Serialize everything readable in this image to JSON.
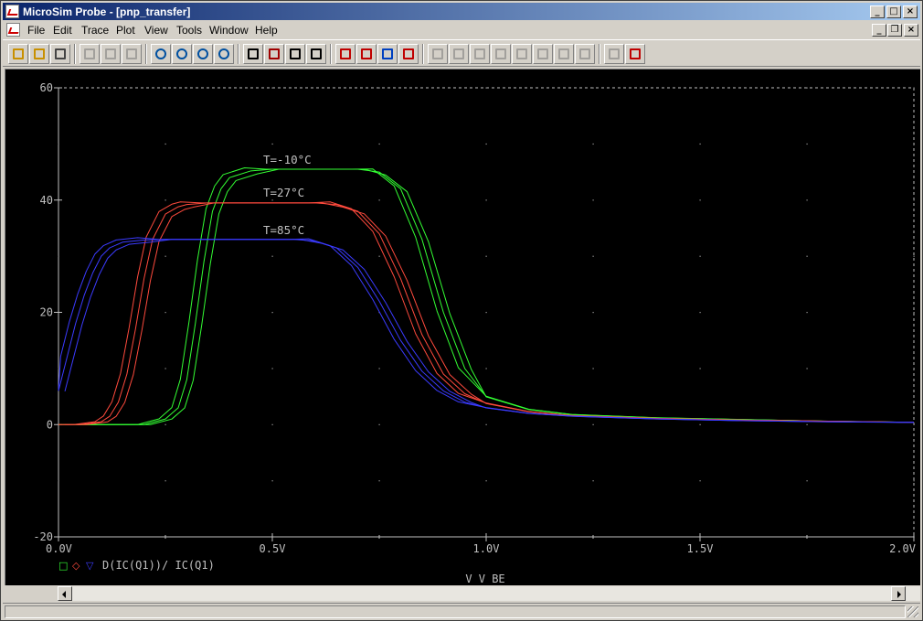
{
  "window": {
    "title": "MicroSim Probe - [pnp_transfer]",
    "caption_buttons": [
      "_",
      "□",
      "×"
    ],
    "mdi_buttons": [
      "_",
      "❐",
      "×"
    ]
  },
  "menu": [
    "File",
    "Edit",
    "Trace",
    "Plot",
    "View",
    "Tools",
    "Window",
    "Help"
  ],
  "toolbar": {
    "buttons": [
      {
        "name": "open-icon",
        "enabled": true
      },
      {
        "name": "append-icon",
        "enabled": true
      },
      {
        "name": "print-icon",
        "enabled": true
      },
      {
        "name": "cut-icon",
        "enabled": false
      },
      {
        "name": "copy-icon",
        "enabled": false
      },
      {
        "name": "paste-icon",
        "enabled": false
      },
      {
        "name": "zoom-in-icon",
        "enabled": true
      },
      {
        "name": "zoom-out-icon",
        "enabled": true
      },
      {
        "name": "zoom-area-icon",
        "enabled": true
      },
      {
        "name": "zoom-fit-icon",
        "enabled": true
      },
      {
        "name": "log-x-icon",
        "enabled": true
      },
      {
        "name": "fourier-icon",
        "enabled": true
      },
      {
        "name": "performance-icon",
        "enabled": true
      },
      {
        "name": "x-axis-icon",
        "enabled": true
      },
      {
        "name": "add-trace-icon",
        "enabled": true
      },
      {
        "name": "eval-goal-icon",
        "enabled": true
      },
      {
        "name": "text-label-icon",
        "enabled": true
      },
      {
        "name": "toggle-cursor-icon",
        "enabled": true
      },
      {
        "name": "cursor-peak-icon",
        "enabled": false
      },
      {
        "name": "cursor-trough-icon",
        "enabled": false
      },
      {
        "name": "cursor-slope-icon",
        "enabled": false
      },
      {
        "name": "cursor-min-icon",
        "enabled": false
      },
      {
        "name": "cursor-max-icon",
        "enabled": false
      },
      {
        "name": "cursor-point-icon",
        "enabled": false
      },
      {
        "name": "cursor-search-icon",
        "enabled": false
      },
      {
        "name": "cursor-next-transition-icon",
        "enabled": false
      },
      {
        "name": "mark-label-icon",
        "enabled": false
      },
      {
        "name": "mark-data-icon",
        "enabled": true
      }
    ]
  },
  "colors": {
    "background": "#000000",
    "axes": "#c0c0c0",
    "t_minus10": "#33ff33",
    "t_27": "#ff4a3d",
    "t_85": "#3b3bff"
  },
  "chart_data": {
    "type": "line",
    "xlabel": "V_V_BE",
    "x_tick_labels": [
      "0.0V",
      "0.5V",
      "1.0V",
      "1.5V",
      "2.0V"
    ],
    "y_tick_labels": [
      "60",
      "40",
      "20",
      "0",
      "-20"
    ],
    "xlim": [
      0,
      2.0
    ],
    "ylim": [
      -20,
      60
    ],
    "grid": "dotted",
    "legend": {
      "expression": "D(IC(Q1))/ IC(Q1)",
      "markers": [
        "□",
        "◇",
        "▽"
      ],
      "placement": "bottom-left"
    },
    "annotations": [
      "T=-10°C",
      "T=27°C",
      "T=85°C"
    ],
    "series": [
      {
        "name": "T=-10°C",
        "color": "#33ff33",
        "plateau": 45.5,
        "x": [
          0.0,
          0.2,
          0.25,
          0.28,
          0.3,
          0.32,
          0.34,
          0.36,
          0.38,
          0.4,
          0.45,
          0.5,
          0.6,
          0.7,
          0.75,
          0.8,
          0.85,
          0.9,
          0.95,
          1.0,
          1.1,
          1.2,
          1.4,
          1.6,
          1.8,
          2.0
        ],
        "y": [
          0,
          0,
          1,
          3,
          8,
          18,
          29,
          38,
          42,
          44,
          45.2,
          45.5,
          45.5,
          45.5,
          45,
          42,
          33,
          20,
          10,
          5,
          2.7,
          1.8,
          1.2,
          0.9,
          0.6,
          0.4
        ]
      },
      {
        "name": "T=27°C",
        "color": "#ff4a3d",
        "plateau": 39.5,
        "x": [
          0.0,
          0.05,
          0.1,
          0.12,
          0.14,
          0.16,
          0.18,
          0.2,
          0.22,
          0.25,
          0.28,
          0.3,
          0.35,
          0.4,
          0.5,
          0.6,
          0.65,
          0.7,
          0.75,
          0.8,
          0.85,
          0.9,
          0.95,
          1.0,
          1.1,
          1.2,
          1.4,
          1.6,
          1.8,
          2.0
        ],
        "y": [
          0,
          0,
          0.5,
          1.5,
          4,
          9,
          17,
          26,
          33,
          37.5,
          38.8,
          39.2,
          39.5,
          39.5,
          39.5,
          39.5,
          39.2,
          38,
          34,
          26,
          16,
          9,
          5.5,
          3.8,
          2.3,
          1.6,
          1.1,
          0.8,
          0.6,
          0.4
        ]
      },
      {
        "name": "T=85°C",
        "color": "#3b3bff",
        "plateau": 33,
        "x": [
          0.0,
          0.02,
          0.04,
          0.06,
          0.08,
          0.1,
          0.12,
          0.15,
          0.2,
          0.25,
          0.3,
          0.4,
          0.5,
          0.55,
          0.6,
          0.65,
          0.7,
          0.75,
          0.8,
          0.85,
          0.9,
          0.95,
          1.0,
          1.1,
          1.2,
          1.4,
          1.6,
          1.8,
          2.0
        ],
        "y": [
          6,
          12,
          18,
          23,
          27,
          30,
          31.5,
          32.5,
          32.9,
          33,
          33,
          33,
          33,
          33,
          32.7,
          31.5,
          28,
          22,
          15,
          9.5,
          6,
          4,
          3,
          2,
          1.5,
          1,
          0.7,
          0.5,
          0.4
        ]
      }
    ]
  }
}
